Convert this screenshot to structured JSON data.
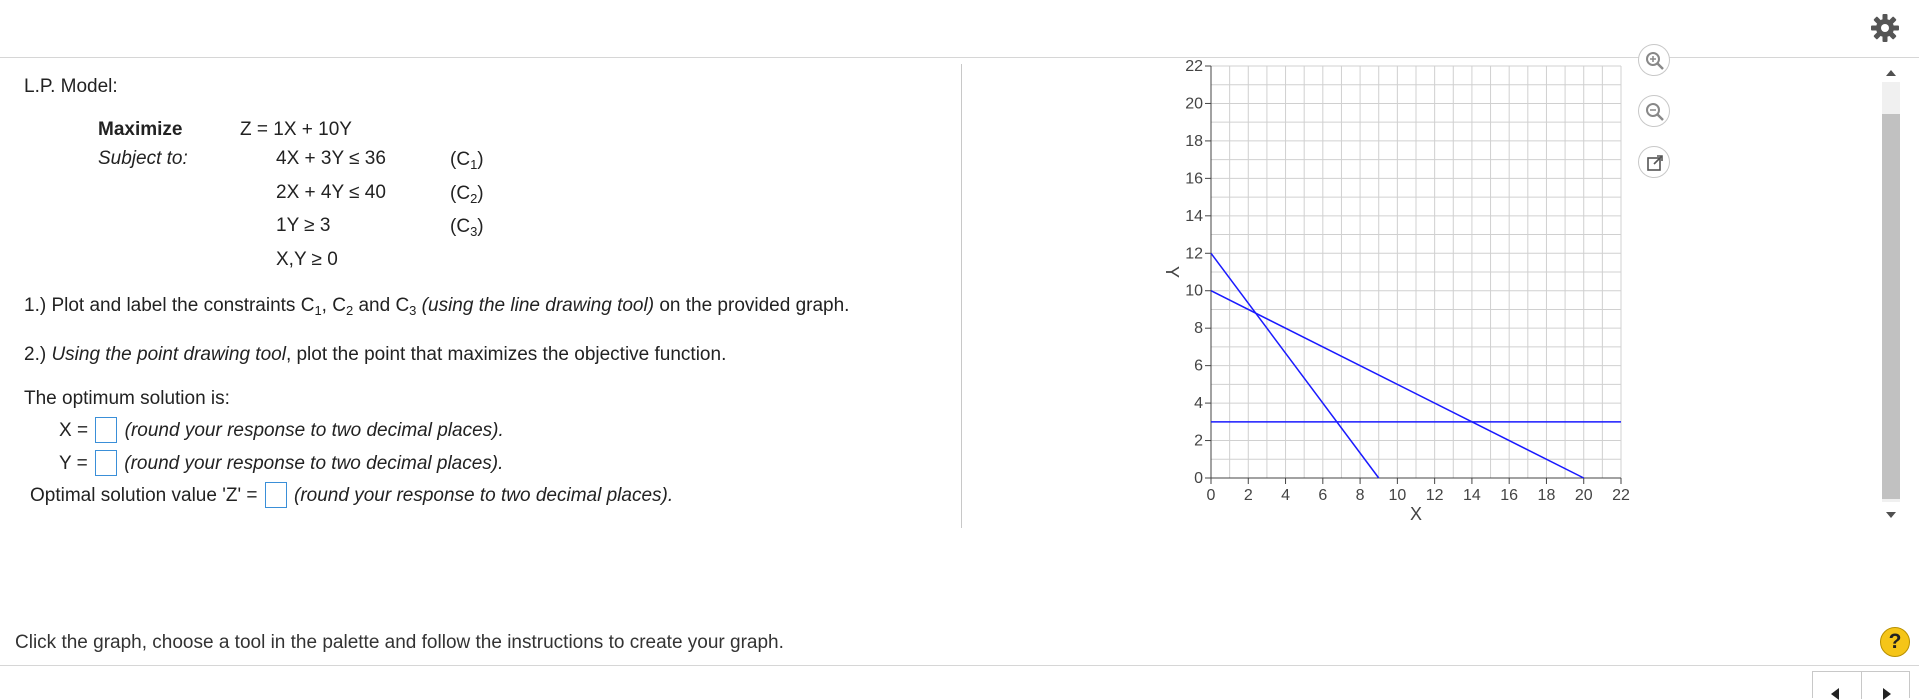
{
  "model": {
    "title": "L.P. Model:",
    "maximize_label": "Maximize",
    "subject_to_label": "Subject to:",
    "objective": "Z = 1X + 10Y",
    "constraints": [
      {
        "expr": "4X + 3Y ≤ 36",
        "tag": "(C",
        "sub": "1",
        "close": ")"
      },
      {
        "expr": "2X + 4Y ≤ 40",
        "tag": "(C",
        "sub": "2",
        "close": ")"
      },
      {
        "expr": "1Y ≥ 3",
        "tag": "(C",
        "sub": "3",
        "close": ")"
      }
    ],
    "nonneg": "X,Y ≥ 0"
  },
  "q1": {
    "a": "1.) Plot and label the constraints C",
    "s1": "1",
    "b": ", C",
    "s2": "2",
    "c": " and C",
    "s3": "3",
    "it": " (using the line drawing tool)",
    "d": " on the provided graph."
  },
  "q2": {
    "a": "2.) ",
    "it": "Using the point drawing tool",
    "b": ", plot the point that maximizes the objective function."
  },
  "solution": {
    "heading": "The optimum solution is:",
    "x_label": "X =",
    "y_label": "Y =",
    "z_label": "Optimal solution value 'Z'  =",
    "round_note": "(round your response to two decimal places).",
    "x_value": "",
    "y_value": "",
    "z_value": ""
  },
  "footer": {
    "instruction": "Click the graph, choose a tool in the palette and follow the instructions to create your graph.",
    "help": "?"
  },
  "colors": {
    "line": "#1a1aff",
    "grid": "#d0d0d0",
    "input_border": "#3a8fd8"
  },
  "icons": {
    "settings": "gear-icon",
    "zoom_in": "zoom-in-icon",
    "zoom_out": "zoom-out-icon",
    "popout": "external-link-icon"
  },
  "chart_data": {
    "type": "line",
    "xlabel": "X",
    "ylabel": "Y",
    "xlim": [
      0,
      22
    ],
    "ylim": [
      0,
      22
    ],
    "x_ticks": [
      0,
      2,
      4,
      6,
      8,
      10,
      12,
      14,
      16,
      18,
      20,
      22
    ],
    "y_ticks": [
      0,
      2,
      4,
      6,
      8,
      10,
      12,
      14,
      16,
      18,
      20,
      22
    ],
    "grid": true,
    "series": [
      {
        "points": [
          [
            0,
            12
          ],
          [
            9,
            0
          ]
        ]
      },
      {
        "points": [
          [
            0,
            10
          ],
          [
            20,
            0
          ]
        ]
      },
      {
        "points": [
          [
            0,
            3
          ],
          [
            22,
            3
          ]
        ]
      }
    ]
  }
}
